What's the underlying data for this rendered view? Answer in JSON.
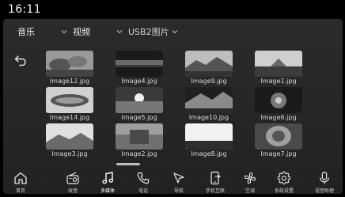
{
  "status": {
    "time": "16:11"
  },
  "tabs": {
    "music": "音乐",
    "video": "视频",
    "usb_pictures": "USB2图片"
  },
  "gallery": {
    "items": [
      {
        "name": "Image12.jpg",
        "icon": "image-thumbnail"
      },
      {
        "name": "Image4.jpg",
        "icon": "image-thumbnail"
      },
      {
        "name": "Image9.jpg",
        "icon": "image-thumbnail"
      },
      {
        "name": "Image1.jpg",
        "icon": "image-thumbnail"
      },
      {
        "name": "Image14.jpg",
        "icon": "image-thumbnail"
      },
      {
        "name": "Image5.jpg",
        "icon": "image-thumbnail"
      },
      {
        "name": "Image10.jpg",
        "icon": "image-thumbnail"
      },
      {
        "name": "Image6.jpg",
        "icon": "image-thumbnail"
      },
      {
        "name": "Image3.jpg",
        "icon": "image-thumbnail"
      },
      {
        "name": "Image2.jpg",
        "icon": "image-thumbnail"
      },
      {
        "name": "Image8.jpg",
        "icon": "image-thumbnail"
      },
      {
        "name": "Image7.jpg",
        "icon": "image-thumbnail"
      }
    ]
  },
  "dock": {
    "items": [
      {
        "label": "首页",
        "icon": "home-icon"
      },
      {
        "label": "收音",
        "icon": "radio-icon"
      },
      {
        "label": "多媒体",
        "icon": "music-note-icon"
      },
      {
        "label": "电话",
        "icon": "phone-icon"
      },
      {
        "label": "导航",
        "icon": "navigation-icon"
      },
      {
        "label": "手机互联",
        "icon": "phone-link-icon"
      },
      {
        "label": "空调",
        "icon": "fan-icon"
      },
      {
        "label": "系统设置",
        "icon": "gear-icon"
      },
      {
        "label": "语音助理",
        "icon": "microphone-icon"
      }
    ],
    "active": "多媒体"
  },
  "colors": {
    "background": "#262626",
    "text": "#e6e6e6"
  }
}
